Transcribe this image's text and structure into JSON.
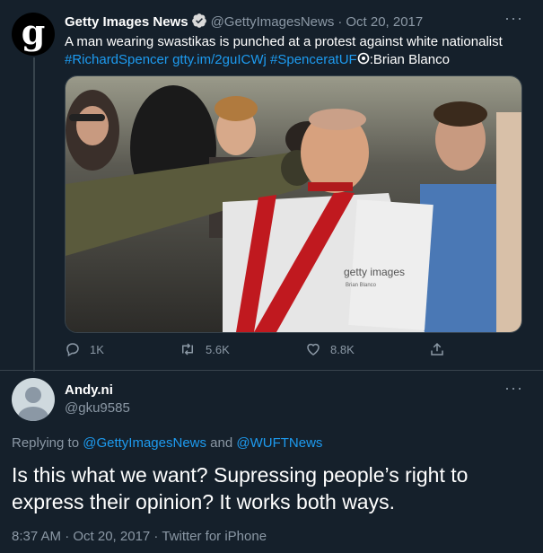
{
  "tweet1": {
    "avatar_letter": "g",
    "name": "Getty Images News",
    "handle": "@GettyImagesNews",
    "date": "Oct 20, 2017",
    "text_plain": "A man wearing swastikas is punched at a protest against white nationalist",
    "hashtag1": "#RichardSpencer",
    "link": "gtty.im/2guICWj",
    "hashtag2": "#SpenceratUF",
    "credit": ":Brian Blanco",
    "photo_watermark": "getty images",
    "photo_watermark_sub": "Brian Blanco",
    "reply_count": "1K",
    "retweet_count": "5.6K",
    "like_count": "8.8K"
  },
  "tweet2": {
    "name": "Andy.ni",
    "handle": "@gku9585",
    "replying_prefix": "Replying to",
    "replying_user1": "@GettyImagesNews",
    "replying_and": "and",
    "replying_user2": "@WUFTNews",
    "text": "Is this what we want? Supressing people’s right to express their opinion? It works both ways.",
    "timestamp": "8:37 AM · Oct 20, 2017 · Twitter for iPhone"
  },
  "icons": {
    "more": "···",
    "separator": "·"
  },
  "colors": {
    "background": "#15202b",
    "accent": "#1d9bf0",
    "muted": "#8b98a5"
  }
}
